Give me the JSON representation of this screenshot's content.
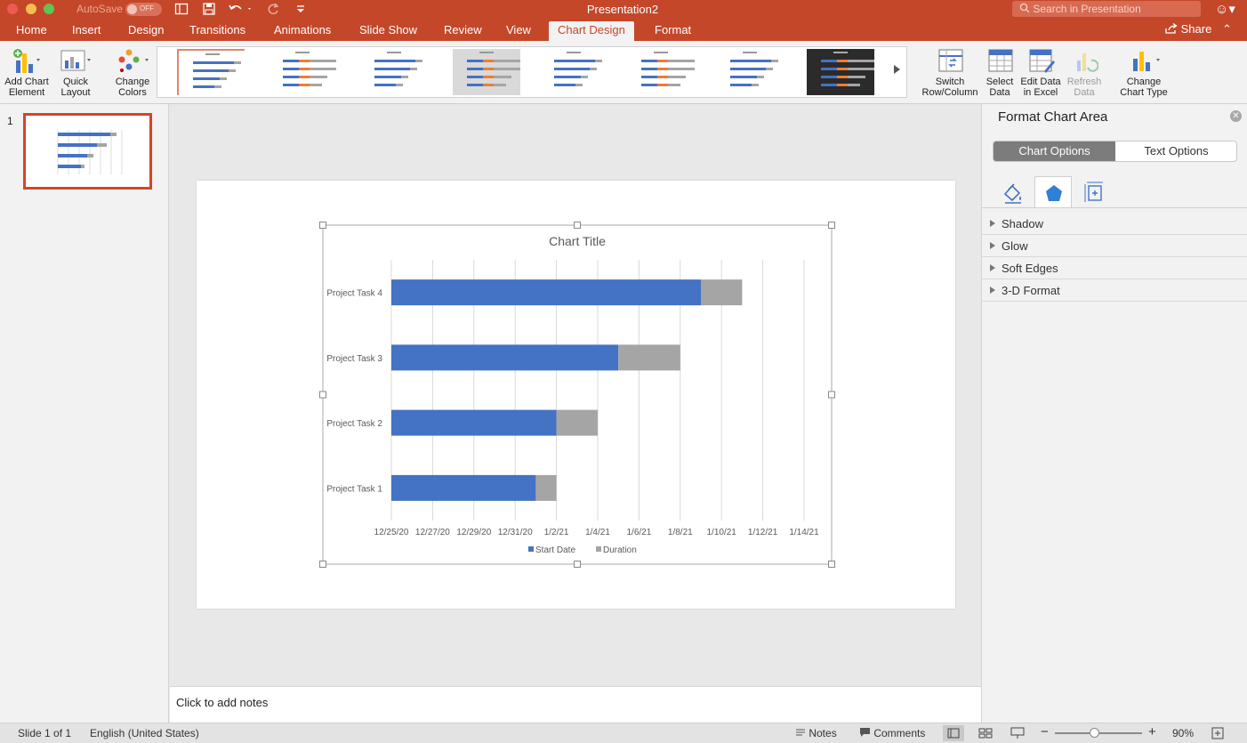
{
  "titlebar": {
    "autosave_label": "AutoSave",
    "autosave_state": "OFF",
    "document_title": "Presentation2",
    "search_placeholder": "Search in Presentation",
    "accent_color": "#c4472a"
  },
  "tabs": [
    "Home",
    "Insert",
    "Design",
    "Transitions",
    "Animations",
    "Slide Show",
    "Review",
    "View",
    "Chart Design",
    "Format"
  ],
  "active_tab": "Chart Design",
  "share_label": "Share",
  "ribbon": {
    "add_chart_element": [
      "Add Chart",
      "Element"
    ],
    "quick_layout": [
      "Quick",
      "Layout"
    ],
    "change_colors": [
      "Change",
      "Colors"
    ],
    "switch_row_column": [
      "Switch",
      "Row/Column"
    ],
    "select_data": [
      "Select",
      "Data"
    ],
    "edit_data_excel": [
      "Edit Data",
      "in Excel"
    ],
    "refresh_data": [
      "Refresh",
      "Data"
    ],
    "change_chart_type": [
      "Change",
      "Chart Type"
    ]
  },
  "slides_panel": {
    "slide_number": "1"
  },
  "chart_data": {
    "type": "bar",
    "orientation": "horizontal-stacked",
    "title": "Chart Title",
    "categories": [
      "Project Task 1",
      "Project Task 2",
      "Project Task 3",
      "Project Task 4"
    ],
    "series": [
      {
        "name": "Start Date",
        "color": "#4472c4",
        "values": [
          "1/1/21",
          "1/2/21",
          "1/5/21",
          "1/9/21"
        ]
      },
      {
        "name": "Duration",
        "color": "#a5a5a5",
        "values": [
          1,
          2,
          3,
          2
        ]
      }
    ],
    "x_ticks": [
      "12/25/20",
      "12/27/20",
      "12/29/20",
      "12/31/20",
      "1/2/21",
      "1/4/21",
      "1/6/21",
      "1/8/21",
      "1/10/21",
      "1/12/21",
      "1/14/21"
    ],
    "xlim": [
      "12/25/20",
      "1/14/21"
    ],
    "grid": true,
    "legend": "bottom"
  },
  "notes_placeholder": "Click to add notes",
  "format_pane": {
    "title": "Format Chart Area",
    "chart_options": "Chart Options",
    "text_options": "Text Options",
    "sections": [
      "Shadow",
      "Glow",
      "Soft Edges",
      "3-D Format"
    ]
  },
  "statusbar": {
    "slide_info": "Slide 1 of 1",
    "language": "English (United States)",
    "notes": "Notes",
    "comments": "Comments",
    "zoom": "90%"
  }
}
